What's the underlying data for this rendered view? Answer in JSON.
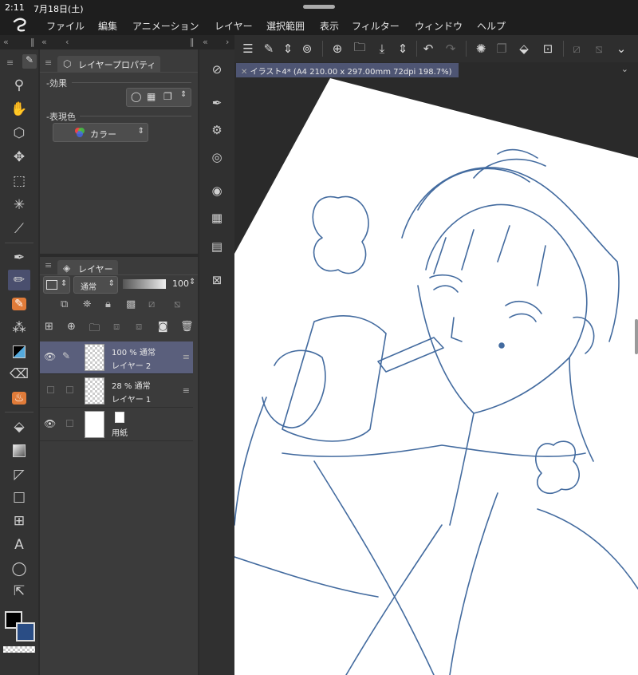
{
  "status": {
    "time": "2:11",
    "date": "7月18日(土)"
  },
  "menu": {
    "items": [
      "ファイル",
      "編集",
      "アニメーション",
      "レイヤー",
      "選択範囲",
      "表示",
      "フィルター",
      "ウィンドウ",
      "ヘルプ"
    ]
  },
  "property_panel": {
    "tab_label": "レイヤープロパティ",
    "effect_label": "効果",
    "expression_label": "表現色",
    "expression_value": "カラー"
  },
  "layer_panel": {
    "tab_label": "レイヤー",
    "blend_mode": "通常",
    "opacity": "100",
    "layers": [
      {
        "percent_mode": "100 % 通常",
        "name": "レイヤー 2"
      },
      {
        "percent_mode": "28 % 通常",
        "name": "レイヤー 1"
      },
      {
        "percent_mode": "",
        "name": "用紙"
      }
    ]
  },
  "canvas": {
    "tab_label": "イラスト4* (A4 210.00 x 297.00mm 72dpi 198.7%)"
  },
  "colors": {
    "main": "#000000",
    "sub": "#2a4d85",
    "sketch": "#2f5b95"
  },
  "icons": {
    "tools": [
      "zoom-icon",
      "hand-icon",
      "object-icon",
      "move-icon",
      "selection-icon",
      "auto-select-icon",
      "eyedropper-icon",
      "pen-icon",
      "pencil-icon",
      "brush-icon",
      "airbrush-icon",
      "decoration-icon",
      "eraser-icon",
      "blend-icon",
      "fill-icon",
      "gradient-icon",
      "figure-icon",
      "frame-icon",
      "ruler-icon",
      "text-icon",
      "balloon-icon",
      "correct-line-icon"
    ]
  }
}
